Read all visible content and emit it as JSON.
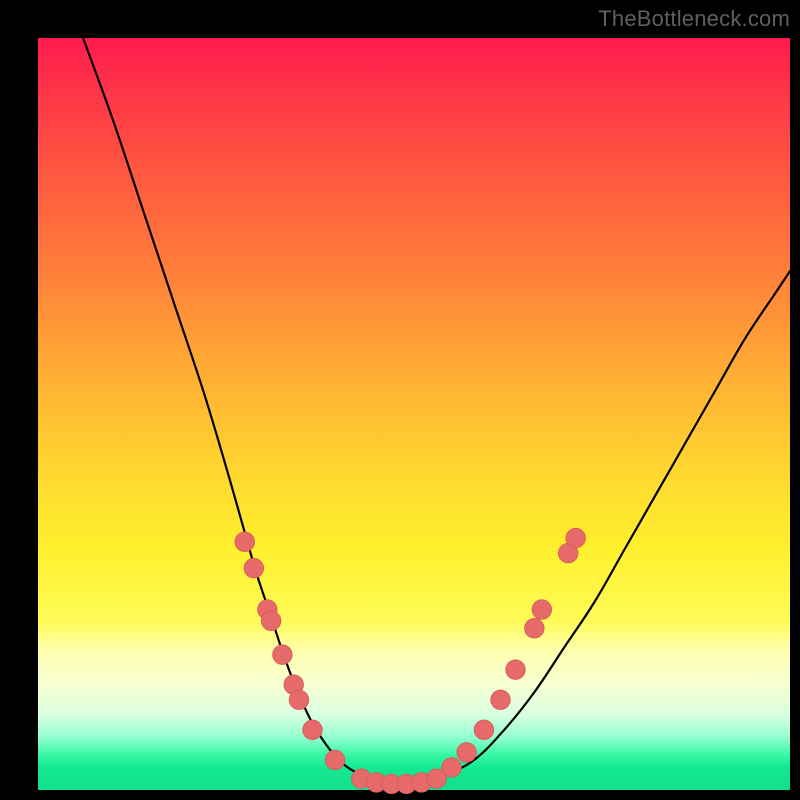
{
  "watermark": "TheBottleneck.com",
  "colors": {
    "curve": "#000000",
    "dot_fill": "#e66a6a",
    "dot_stroke": "#d85858",
    "frame": "#000000"
  },
  "chart_data": {
    "type": "line",
    "title": "",
    "xlabel": "",
    "ylabel": "",
    "xlim": [
      0,
      100
    ],
    "ylim": [
      0,
      100
    ],
    "grid": false,
    "legend": false,
    "note": "Axes have no tick labels in the source image; values below are read in percent of plot width/height (origin at bottom-left).",
    "series": [
      {
        "name": "bottleneck-curve",
        "x": [
          6,
          10,
          14,
          18,
          22,
          25,
          27,
          29,
          31,
          33,
          35,
          37,
          40,
          43,
          46,
          50,
          54,
          58,
          62,
          66,
          70,
          74,
          78,
          82,
          86,
          90,
          94,
          98,
          100
        ],
        "y": [
          100,
          89,
          77,
          65,
          53,
          43,
          36,
          29,
          23,
          17,
          12,
          8,
          4,
          2,
          1,
          1,
          2,
          4,
          8,
          13,
          19,
          25,
          32,
          39,
          46,
          53,
          60,
          66,
          69
        ]
      }
    ],
    "points": {
      "name": "highlighted-samples",
      "coords": [
        [
          27.5,
          33.0
        ],
        [
          28.7,
          29.5
        ],
        [
          30.5,
          24.0
        ],
        [
          31.0,
          22.5
        ],
        [
          32.5,
          18.0
        ],
        [
          34.0,
          14.0
        ],
        [
          34.7,
          12.0
        ],
        [
          36.5,
          8.0
        ],
        [
          39.5,
          4.0
        ],
        [
          43.0,
          1.5
        ],
        [
          45.0,
          1.0
        ],
        [
          47.0,
          0.8
        ],
        [
          49.0,
          0.8
        ],
        [
          51.0,
          1.0
        ],
        [
          53.0,
          1.5
        ],
        [
          55.0,
          3.0
        ],
        [
          57.0,
          5.0
        ],
        [
          59.3,
          8.0
        ],
        [
          61.5,
          12.0
        ],
        [
          63.5,
          16.0
        ],
        [
          66.0,
          21.5
        ],
        [
          67.0,
          24.0
        ],
        [
          70.5,
          31.5
        ],
        [
          71.5,
          33.5
        ]
      ],
      "radius_pct": 1.3
    }
  }
}
